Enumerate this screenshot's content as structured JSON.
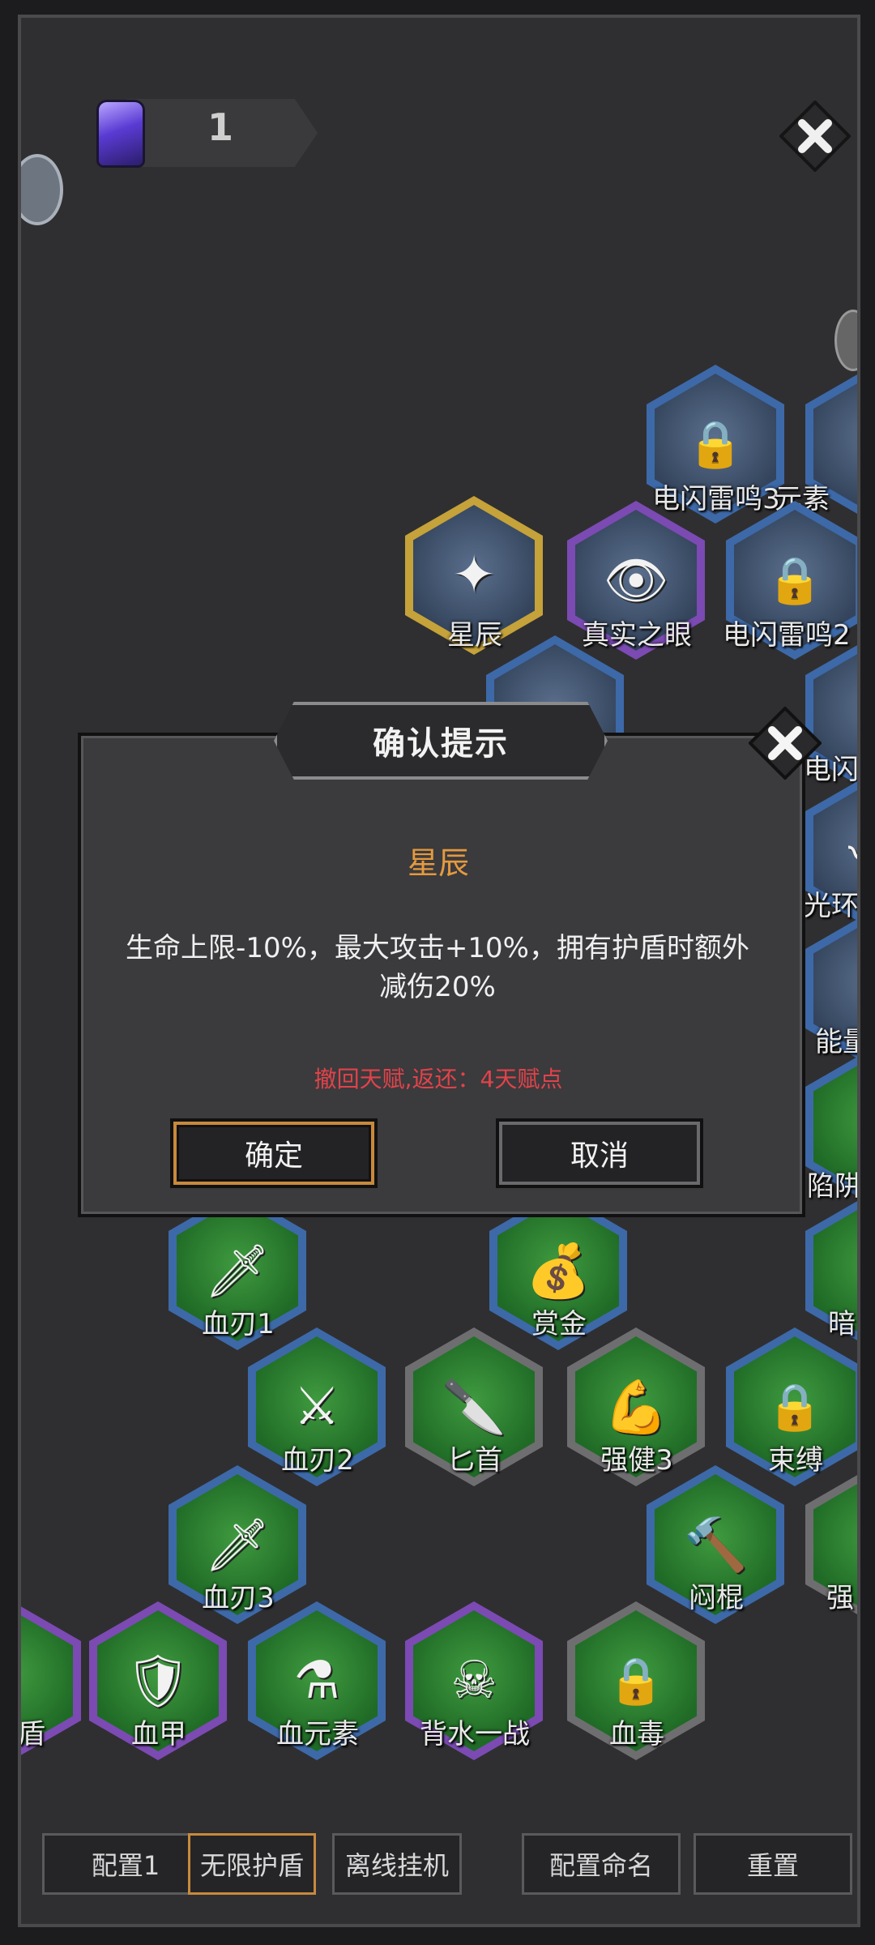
{
  "currency": {
    "icon": "crystal-icon",
    "count": "1"
  },
  "talents": [
    {
      "label": "电闪雷鸣3"
    },
    {
      "label": "元素"
    },
    {
      "label": "星辰"
    },
    {
      "label": "真实之眼"
    },
    {
      "label": "电闪雷鸣2"
    },
    {
      "label": "电闪"
    },
    {
      "label": "光环"
    },
    {
      "label": "能量"
    },
    {
      "label": "陷阱"
    },
    {
      "label": "血刃1"
    },
    {
      "label": "赏金"
    },
    {
      "label": "暗"
    },
    {
      "label": "血刃2"
    },
    {
      "label": "匕首"
    },
    {
      "label": "强健3"
    },
    {
      "label": "束缚"
    },
    {
      "label": "血刃3"
    },
    {
      "label": "闷棍"
    },
    {
      "label": "强"
    },
    {
      "label": "盾"
    },
    {
      "label": "血甲"
    },
    {
      "label": "血元素"
    },
    {
      "label": "背水一战"
    },
    {
      "label": "血毒"
    }
  ],
  "dialog": {
    "title": "确认提示",
    "talent_name": "星辰",
    "description": "生命上限-10%，最大攻击+10%，拥有护盾时额外减伤20%",
    "refund": "撤回天赋,返还：4天赋点",
    "confirm": "确定",
    "cancel": "取消"
  },
  "bottom_bar": {
    "config1": "配置1",
    "infinite_shield": "无限护盾",
    "offline": "离线挂机",
    "rename": "配置命名",
    "reset": "重置"
  },
  "colors": {
    "accent_orange": "#e49a3e",
    "refund_red": "#e1434a",
    "active_border": "#c8893c"
  }
}
